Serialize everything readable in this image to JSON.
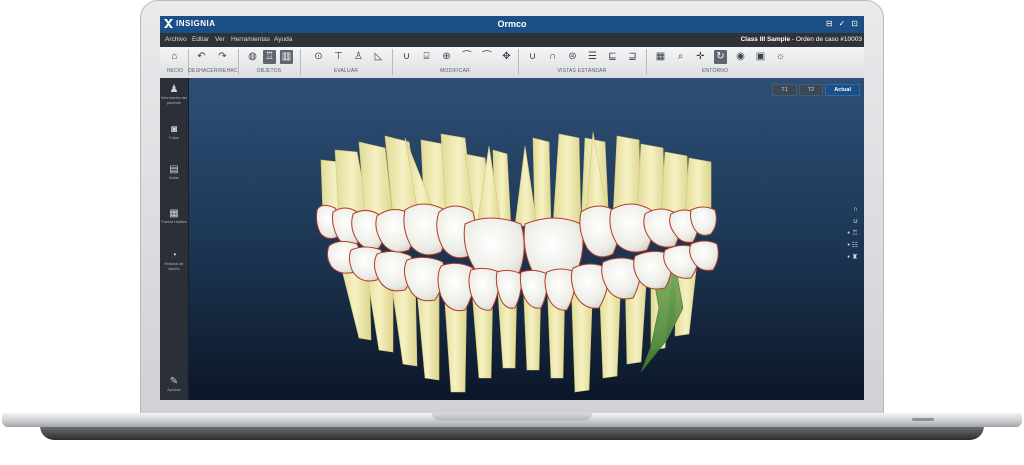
{
  "titlebar": {
    "logo_text": "INSIGNIA",
    "title": "Ormco",
    "controls": [
      "⊟",
      "✓",
      "⊡"
    ]
  },
  "menubar": {
    "items": [
      "Archivo",
      "Editar",
      "Ver",
      "Herramientas",
      "Ayuda"
    ],
    "case_name": "Class III Sample",
    "case_suffix": " - Orden de caso #10003"
  },
  "toolbar": {
    "groups": [
      "INICIO",
      "DESHACER/REHAC",
      "OBJETOS",
      "EVALUAR",
      "MODIFICAR",
      "VISTAS ESTÁNDAR",
      "ENTORNO"
    ],
    "tools": {
      "home": "home-icon",
      "undo": "undo-icon",
      "redo": "redo-icon",
      "objects": [
        "gingiva-icon",
        "teeth-icon",
        "roots-icon"
      ],
      "evaluate": [
        "measure-icon",
        "overjet-icon",
        "crown-icon",
        "triangle-icon"
      ],
      "modify": [
        "arch-icon",
        "ipr-icon",
        "target-icon",
        "crowns-row-icon",
        "move-icon"
      ],
      "views": [
        "upper-arch-icon",
        "lower-arch-icon",
        "front-view-icon",
        "bite-icon",
        "left-side-icon",
        "right-side-icon"
      ],
      "environment": [
        "grid-icon",
        "zoom-icon",
        "pan-icon",
        "rotate-icon",
        "visibility-icon",
        "background-icon",
        "light-icon"
      ]
    }
  },
  "sidebar": {
    "items": [
      {
        "label": "Información del paciente",
        "icon": "patient-icon"
      },
      {
        "label": "Fotos",
        "icon": "camera-icon"
      },
      {
        "label": "Notas",
        "icon": "notes-icon"
      },
      {
        "label": "Fuerza relativa",
        "icon": "chart-icon"
      },
      {
        "label": "Historial de diseño",
        "icon": "history-icon"
      },
      {
        "label": "Aprobar",
        "icon": "approve-icon"
      }
    ]
  },
  "viewport": {
    "stage_tabs": [
      "T1",
      "T2",
      "Actual"
    ],
    "active_stage": "Actual",
    "view_icons": [
      "upper-arch-icon",
      "lower-arch-icon",
      "upper-teeth-icon",
      "bite-icon",
      "lower-teeth-icon"
    ]
  },
  "colors": {
    "title_bar": "#1c4f86",
    "tooth_root": "#f1ebb0",
    "tooth_crown": "#f7f7f3",
    "gingival_line": "#b23a2a",
    "highlight_root": "#5e9a4a"
  }
}
